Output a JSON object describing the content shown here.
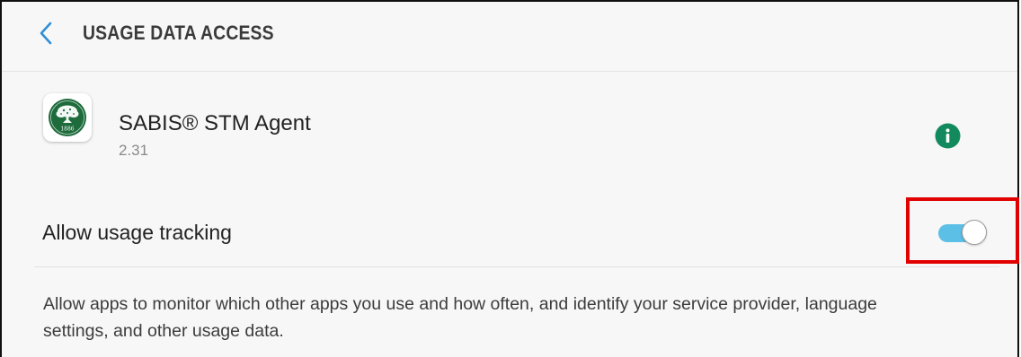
{
  "header": {
    "title": "USAGE DATA ACCESS",
    "back_icon": "chevron-left-icon"
  },
  "app": {
    "name": "SABIS® STM Agent",
    "version": "2.31",
    "logo_year": "1886",
    "icon": "sabis-tree-logo",
    "info_icon": "info-icon"
  },
  "setting": {
    "label": "Allow usage tracking",
    "enabled": true,
    "description": "Allow apps to monitor which other apps you use and how often, and identify your service provider, language settings, and other usage data."
  },
  "colors": {
    "accent": "#5bbfe6",
    "info": "#138a5e",
    "logo_green": "#1e6b3c",
    "highlight": "#e10000",
    "back_chevron": "#2f8fd6"
  }
}
